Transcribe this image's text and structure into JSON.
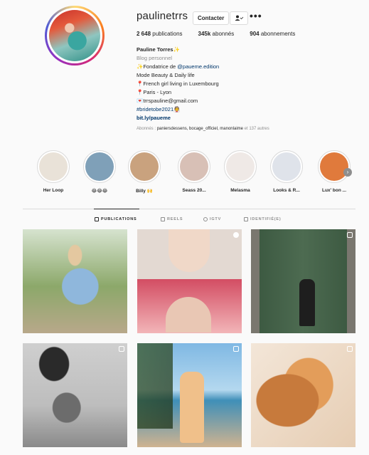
{
  "profile": {
    "username": "paulinetrrs",
    "contact_button": "Contacter",
    "follow_icon": "person-check-icon",
    "more": "•••",
    "stats": {
      "posts_value": "2 648",
      "posts_label": "publications",
      "followers_value": "345k",
      "followers_label": "abonnés",
      "following_value": "904",
      "following_label": "abonnements"
    },
    "bio": {
      "name": "Pauline Torres✨",
      "category": "Blog personnel",
      "line1_prefix": "✨Fondatrice de ",
      "line1_link": "@paueme.edition",
      "line2": "Mode Beauty & Daily life",
      "line3": "📍French girl living in Luxembourg",
      "line4": "📍Paris - Lyon",
      "line5": "💌trrspauline@gmail.com",
      "line6": "#bridetobe2021👰",
      "website": "bit.ly/paueme"
    },
    "followers_prefix": "Abonnés : ",
    "followers_names": "paniersdessens, bocage_officiel, manonlaime",
    "followers_suffix": " et 137 autres"
  },
  "highlights": [
    {
      "label": "Her Loop",
      "color": "#e9e2d8"
    },
    {
      "label": "😂😂😂",
      "color": "#7fa0b8"
    },
    {
      "label": "Billy 🙌",
      "color": "#c9a27e"
    },
    {
      "label": "Seass 20...",
      "color": "#d8c0b6"
    },
    {
      "label": "Melasma",
      "color": "#efe9e6"
    },
    {
      "label": "Looks & R...",
      "color": "#dfe3ea"
    },
    {
      "label": "Lux' bon ...",
      "color": "#e07a3c"
    }
  ],
  "tabs": [
    {
      "label": "PUBLICATIONS",
      "icon": "grid-icon",
      "active": true
    },
    {
      "label": "REELS",
      "icon": "reels-icon",
      "active": false
    },
    {
      "label": "IGTV",
      "icon": "igtv-icon",
      "active": false
    },
    {
      "label": "IDENTIFIÉ(E)",
      "icon": "tagged-icon",
      "active": false
    }
  ],
  "posts": [
    {
      "desc": "blue floral dress in garden",
      "badge": ""
    },
    {
      "desc": "beauty video with glasses",
      "badge": "video-icon"
    },
    {
      "desc": "green barn door",
      "badge": "carousel-icon"
    },
    {
      "desc": "black and white swimsuit",
      "badge": "carousel-icon"
    },
    {
      "desc": "seaside yellow dress",
      "badge": "carousel-icon"
    },
    {
      "desc": "pomeranian dog close-up",
      "badge": "carousel-icon"
    }
  ]
}
